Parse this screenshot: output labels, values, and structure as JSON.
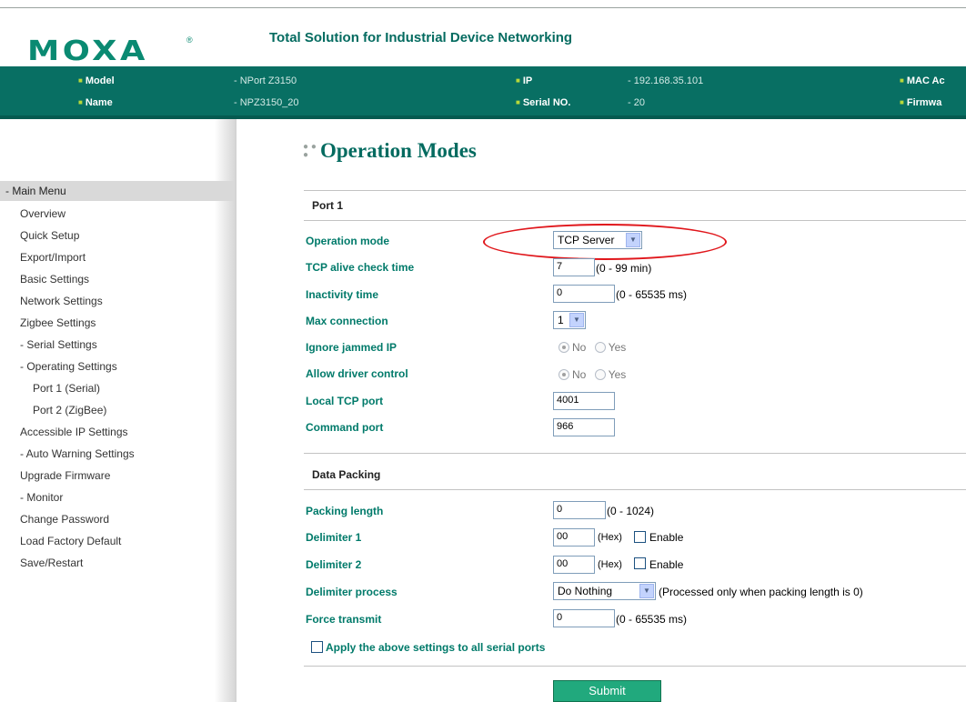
{
  "brand": {
    "logo_text": "MOXA",
    "logo_mark": "®",
    "tagline": "Total Solution for Industrial Device Networking",
    "accent": "#0a8a72",
    "bar_color": "#086f63"
  },
  "device_info": {
    "model_label": "Model",
    "model_value": "- NPort Z3150",
    "name_label": "Name",
    "name_value": "- NPZ3150_20",
    "ip_label": "IP",
    "ip_value": "- 192.168.35.101",
    "serial_label": "Serial NO.",
    "serial_value": "- 20",
    "mac_label": "MAC Ac",
    "firmware_label": "Firmwa"
  },
  "sidebar": {
    "header": "- Main Menu",
    "items": [
      "Overview",
      "Quick Setup",
      "Export/Import",
      "Basic Settings",
      "Network Settings",
      "Zigbee Settings",
      "- Serial Settings",
      "- Operating Settings",
      "Port 1 (Serial)",
      "Port 2 (ZigBee)",
      "Accessible IP Settings",
      "- Auto Warning Settings",
      "Upgrade Firmware",
      "- Monitor",
      "Change Password",
      "Load Factory Default",
      "Save/Restart"
    ]
  },
  "page": {
    "title": "Operation Modes",
    "port_section": "Port 1",
    "data_packing_section": "Data Packing",
    "apply_all_label": "Apply the above settings to all serial ports",
    "submit_label": "Submit"
  },
  "port": {
    "operation_mode": {
      "label": "Operation mode",
      "value": "TCP Server"
    },
    "tcp_alive": {
      "label": "TCP alive check time",
      "value": "7",
      "unit": "(0 - 99 min)"
    },
    "inactivity": {
      "label": "Inactivity time",
      "value": "0",
      "unit": "(0 - 65535 ms)"
    },
    "max_connection": {
      "label": "Max connection",
      "value": "1"
    },
    "ignore_jammed": {
      "label": "Ignore jammed IP",
      "opt_no": "No",
      "opt_yes": "Yes",
      "selected": "No"
    },
    "allow_driver": {
      "label": "Allow driver control",
      "opt_no": "No",
      "opt_yes": "Yes",
      "selected": "No"
    },
    "local_tcp": {
      "label": "Local TCP port",
      "value": "4001"
    },
    "command_port": {
      "label": "Command port",
      "value": "966"
    }
  },
  "packing": {
    "packing_length": {
      "label": "Packing length",
      "value": "0",
      "unit": "(0 - 1024)"
    },
    "delimiter1": {
      "label": "Delimiter 1",
      "value": "00",
      "hex": "(Hex)",
      "enable": "Enable"
    },
    "delimiter2": {
      "label": "Delimiter 2",
      "value": "00",
      "hex": "(Hex)",
      "enable": "Enable"
    },
    "delimiter_process": {
      "label": "Delimiter process",
      "value": "Do Nothing",
      "note": "(Processed only when packing length is 0)"
    },
    "force_transmit": {
      "label": "Force transmit",
      "value": "0",
      "unit": "(0 - 65535 ms)"
    }
  }
}
